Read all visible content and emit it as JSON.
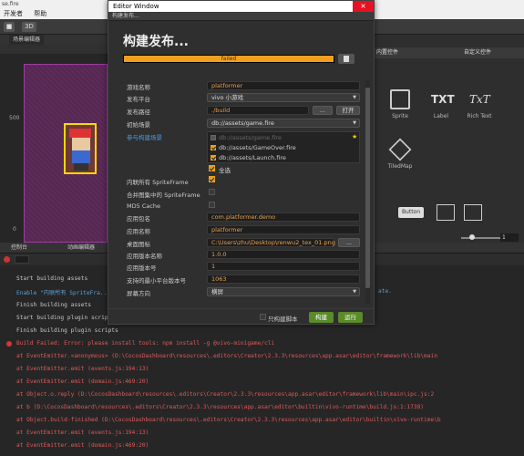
{
  "app": {
    "top_fragment": "se.fire",
    "menu": [
      "开发者",
      "帮助"
    ],
    "toolbar_3d": "3D"
  },
  "scene_panel": {
    "tab_label": "场景编辑器",
    "ruler": [
      "500",
      "0"
    ]
  },
  "right_panel": {
    "tabs": [
      "内置控件",
      "自定义控件"
    ],
    "widgets": [
      "Sprite",
      "Label",
      "Rich Text",
      "TiledMap",
      "Button"
    ],
    "label_glyph": "TXT",
    "richtext_glyph": "TxT",
    "slider_value": "1"
  },
  "console": {
    "tabs": [
      "控制台",
      "动画编辑器"
    ],
    "lines": [
      "Start building assets",
      "Enable \"内联所有 SpriteFra...",
      "Finish building assets",
      "Start building plugin scripts",
      "Finish building plugin scripts",
      "Build Failed: Error: please install tools: npm install -g @vivo-minigame/cli",
      "    at EventEmitter.<anonymous>  (D:\\CocosDashboard\\resources\\.editors\\Creator\\2.3.3\\resources\\app.asar\\editor\\framework\\lib\\main",
      "    at EventEmitter.emit  (events.js:194:13)",
      "    at EventEmitter.emit  (domain.js:469:20)",
      "    at Object.o.reply  (D:\\CocosDashboard\\resources\\.editors\\Creator\\2.3.3\\resources\\app.asar\\editor\\framework\\lib\\main\\ipc.js:2",
      "    at b  (D:\\CocosDashboard\\resources\\.editors\\Creator\\2.3.3\\resources\\app.asar\\editor\\builtin\\vivo-runtime\\build.js:1:1738)",
      "    at Object.build-finished  (D:\\CocosDashboard\\resources\\.editors\\Creator\\2.3.3\\resources\\app.asar\\editor\\builtin\\vivo-runtime\\b",
      "    at EventEmitter.emit  (events.js:194:13)",
      "    at EventEmitter.emit  (domain.js:469:20)"
    ],
    "tail_suffix": "ate."
  },
  "dialog": {
    "window_title": "Editor Window",
    "close_glyph": "×",
    "header_label": "构建发布...",
    "title": "构建发布...",
    "progress_text": "failed",
    "progress_value": 1.0,
    "fields": {
      "game_name_label": "游戏名称",
      "game_name": "platformer",
      "platform_label": "发布平台",
      "platform": "vivo 小游戏",
      "build_path_label": "发布路径",
      "build_path": "./build",
      "dots_button": "...",
      "open_button": "打开",
      "start_scene_label": "初始场景",
      "start_scene": "db://assets/game.fire",
      "scenes_label": "参与构建场景",
      "scenes": [
        "db://assets/game.fire",
        "db://assets/GameOver.fire",
        "db://assets/Launch.fire"
      ],
      "select_all": "全选",
      "inline_spriteframe_label": "内联所有 SpriteFrame",
      "merge_spriteframe_label": "合并图集中的 SpriteFrame",
      "md5_label": "MD5 Cache",
      "package_label": "应用包名",
      "package": "com.platformer.demo",
      "app_name_label": "应用名称",
      "app_name": "platformer",
      "icon_label": "桌面图标",
      "icon": "C:\\Users\\zhu\\Desktop\\renwu2_tex_01.png",
      "icon_button": "...",
      "version_name_label": "应用版本名称",
      "version_name": "1.0.0",
      "version_number_label": "应用版本号",
      "version_number": "1",
      "min_platform_label": "支持的最小平台版本号",
      "min_platform": "1063",
      "orientation_label": "屏幕方向",
      "orientation": "横屏"
    },
    "footer": {
      "only_script": "只构建脚本",
      "build": "构建",
      "run": "运行"
    }
  }
}
